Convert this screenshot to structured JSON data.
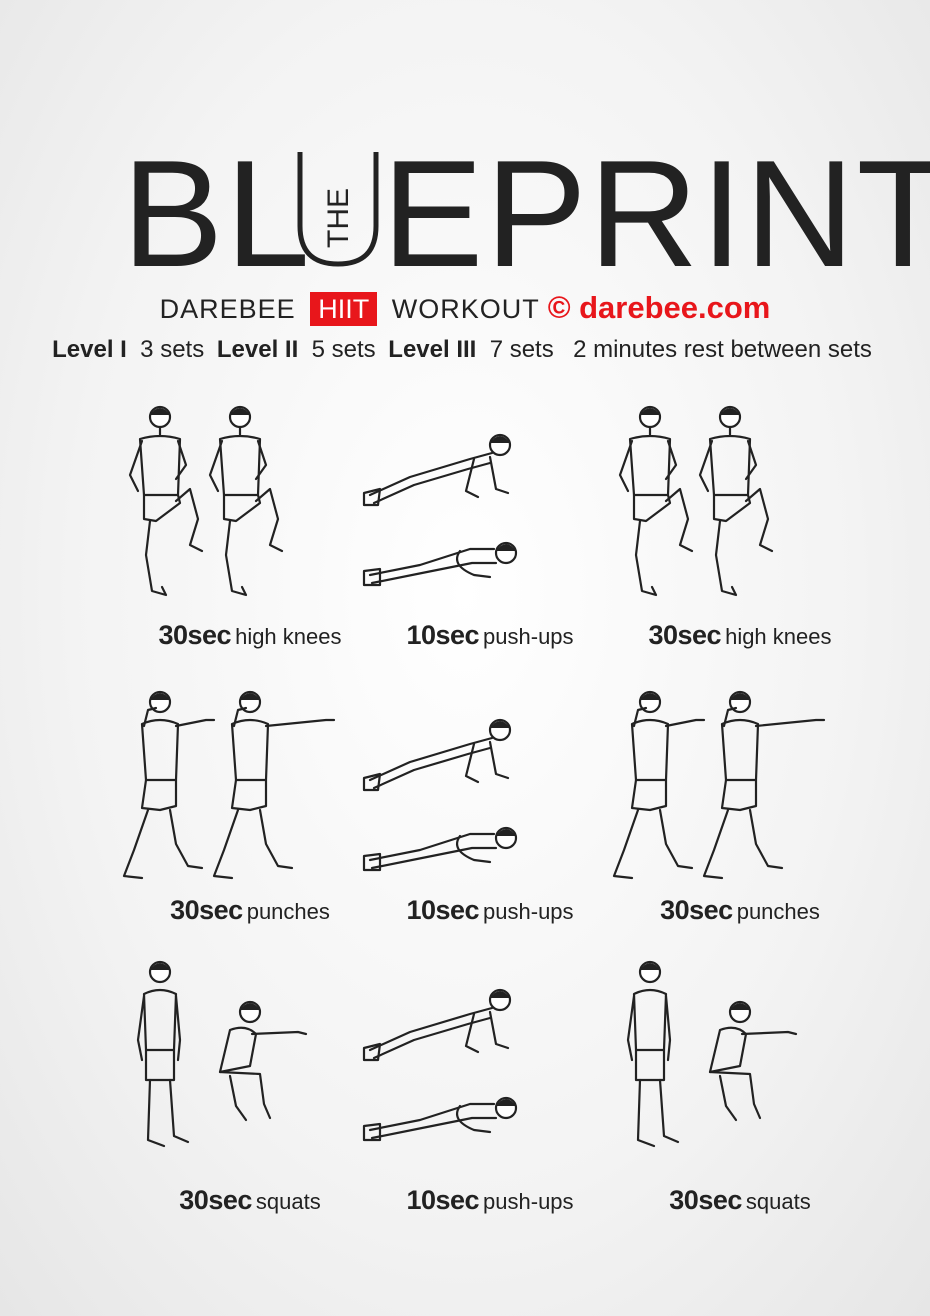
{
  "title": {
    "left": "BL",
    "u": "U",
    "the": "THE",
    "right": "EPRINT"
  },
  "subtitle": {
    "brand": "DAREBEE",
    "badge": "HIIT",
    "workout": "WORKOUT",
    "copyright": "©",
    "url": "darebee.com",
    "accent_color": "#e8161b"
  },
  "levels": [
    {
      "label": "Level I",
      "value": "3 sets"
    },
    {
      "label": "Level II",
      "value": "5 sets"
    },
    {
      "label": "Level III",
      "value": "7 sets"
    }
  ],
  "rest": "2 minutes rest between sets",
  "exercises": [
    {
      "duration": "30sec",
      "name": "high knees",
      "icon": "high-knees-figure"
    },
    {
      "duration": "10sec",
      "name": "push-ups",
      "icon": "push-ups-figure"
    },
    {
      "duration": "30sec",
      "name": "high knees",
      "icon": "high-knees-figure"
    },
    {
      "duration": "30sec",
      "name": "punches",
      "icon": "punches-figure"
    },
    {
      "duration": "10sec",
      "name": "push-ups",
      "icon": "push-ups-figure"
    },
    {
      "duration": "30sec",
      "name": "punches",
      "icon": "punches-figure"
    },
    {
      "duration": "30sec",
      "name": "squats",
      "icon": "squats-figure"
    },
    {
      "duration": "10sec",
      "name": "push-ups",
      "icon": "push-ups-figure"
    },
    {
      "duration": "30sec",
      "name": "squats",
      "icon": "squats-figure"
    }
  ]
}
